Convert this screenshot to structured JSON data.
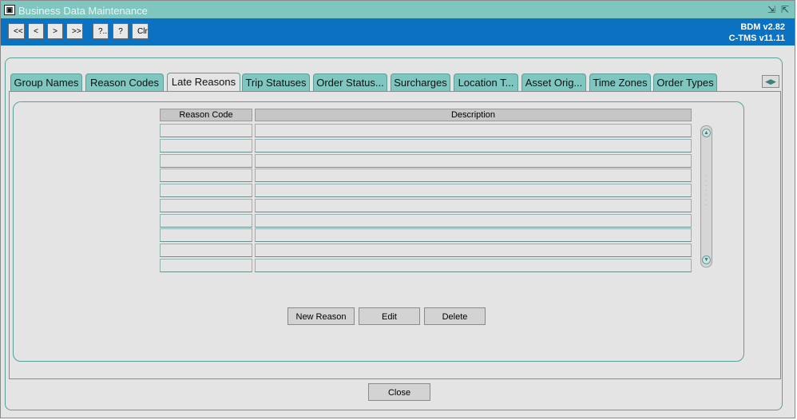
{
  "window": {
    "title": "Business Data Maintenance",
    "icon": "app-icon",
    "controls": [
      "minimize-icon",
      "maximize-icon"
    ]
  },
  "toolbar": {
    "buttons": [
      {
        "label": "<<"
      },
      {
        "label": "<"
      },
      {
        "label": ">"
      },
      {
        "label": ">>"
      },
      {
        "label": "?.."
      },
      {
        "label": "?"
      },
      {
        "label": "Clr"
      }
    ],
    "version_lines": [
      "BDM v2.82",
      "C-TMS v11.11"
    ]
  },
  "tabs": [
    {
      "label": "Group Names",
      "active": false
    },
    {
      "label": "Reason Codes",
      "active": false
    },
    {
      "label": "Late Reasons",
      "active": true
    },
    {
      "label": "Trip Statuses",
      "active": false
    },
    {
      "label": "Order Status...",
      "active": false
    },
    {
      "label": "Surcharges",
      "active": false
    },
    {
      "label": "Location T...",
      "active": false
    },
    {
      "label": "Asset Orig...",
      "active": false
    },
    {
      "label": "Time Zones",
      "active": false
    },
    {
      "label": "Order Types",
      "active": false
    }
  ],
  "grid": {
    "columns": [
      "Reason Code",
      "Description"
    ],
    "rows": [
      [
        "",
        ""
      ],
      [
        "",
        ""
      ],
      [
        "",
        ""
      ],
      [
        "",
        ""
      ],
      [
        "",
        ""
      ],
      [
        "",
        ""
      ],
      [
        "",
        ""
      ],
      [
        "",
        ""
      ],
      [
        "",
        ""
      ],
      [
        "",
        ""
      ]
    ]
  },
  "actions": {
    "new_label": "New Reason",
    "edit_label": "Edit",
    "delete_label": "Delete"
  },
  "footer": {
    "close_label": "Close"
  },
  "colors": {
    "titlebar": "#7fc6c0",
    "toolbar": "#0a72c0",
    "panel": "#e4e4e4",
    "accent_border": "#5b9e9a"
  }
}
